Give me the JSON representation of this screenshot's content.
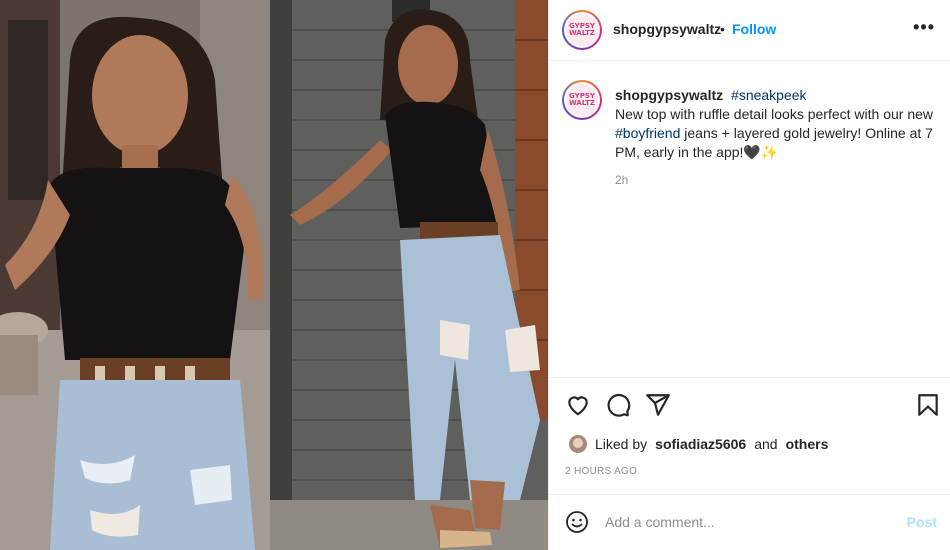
{
  "post": {
    "image_alt": "Woman in black ruffle top and ripped boyfriend jeans posing by a brick wall",
    "username": "shopgypsywaltz",
    "avatar_text_top": "GYPSY",
    "avatar_text_bottom": "WALTZ",
    "separator": "•",
    "follow_label": "Follow",
    "more_label": "•••",
    "caption": {
      "username": "shopgypsywaltz",
      "hashtag_1": "#sneakpeek",
      "text_1": "New top with ruffle detail looks perfect with our new",
      "hashtag_2": "#boyfriend",
      "text_2": "jeans + layered gold jewelry! Online at 7 PM, early in the app!",
      "emoji": "🖤✨"
    },
    "caption_time": "2h",
    "likes": {
      "prefix": "Liked by",
      "user": "sofiadiaz5606",
      "and": "and",
      "others": "others"
    },
    "timestamp": "2 HOURS AGO",
    "comment_placeholder": "Add a comment...",
    "post_label": "Post",
    "icons": [
      "heart-icon",
      "comment-icon",
      "share-icon",
      "bookmark-icon",
      "emoji-icon"
    ],
    "colors": {
      "follow": "#0095f6",
      "hashtag": "#00376b",
      "muted": "#8e8e8e",
      "post_disabled": "#b2dffc"
    }
  }
}
